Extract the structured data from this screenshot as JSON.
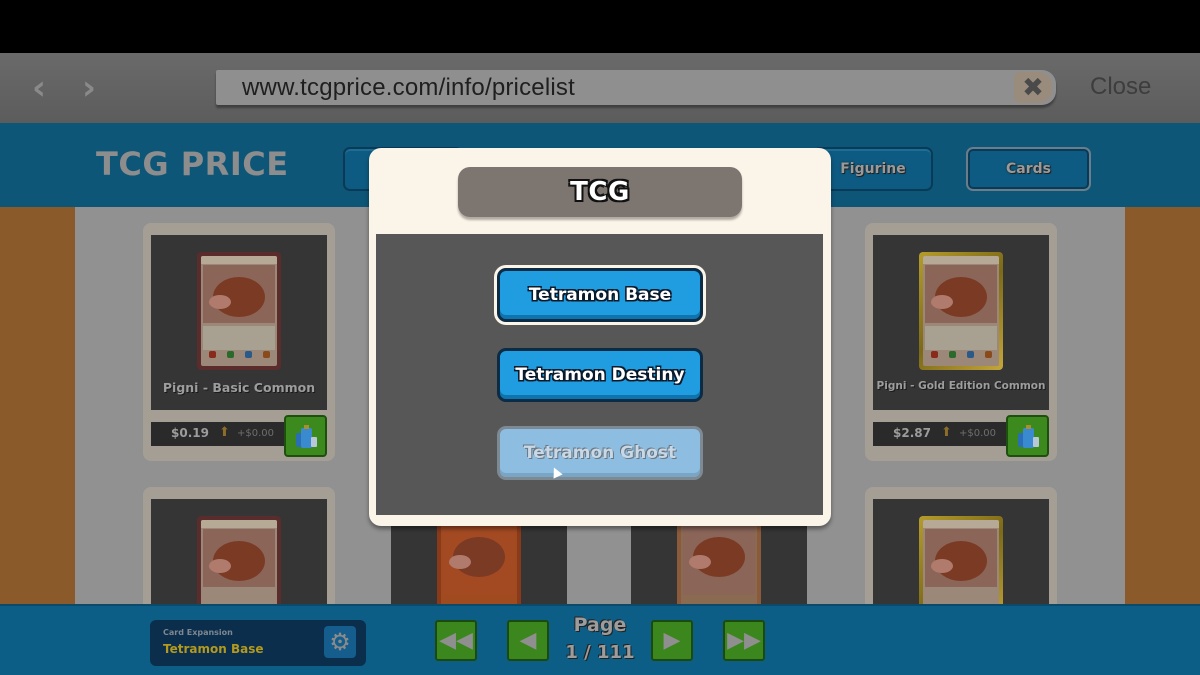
{
  "browser": {
    "back_icon": "chevron-left-icon",
    "forward_icon": "chevron-right-icon",
    "url": "www.tcgprice.com/info/pricelist",
    "clear_icon": "close-x-icon",
    "close_label": "Close"
  },
  "site": {
    "logo": "TCG PRICE",
    "nav": {
      "figurine": "Figurine",
      "cards": "Cards"
    }
  },
  "cards": [
    {
      "name": "Pigni - Basic Common",
      "price": "$0.19",
      "change": "+$0.00",
      "trend_icon": "arrow-up-icon",
      "edition": "basic"
    },
    {
      "name": "Pigni - Gold Edition Common",
      "price": "$2.87",
      "change": "+$0.00",
      "trend_icon": "arrow-up-icon",
      "edition": "gold"
    }
  ],
  "footer": {
    "expansion_label": "Card Expansion",
    "expansion_value": "Tetramon Base",
    "page_label": "Page",
    "page_count": "1 / 111",
    "current_page": 1,
    "total_pages": 111
  },
  "modal": {
    "title": "TCG",
    "options": [
      {
        "label": "Tetramon Base",
        "state": "selected"
      },
      {
        "label": "Tetramon Destiny",
        "state": "enabled"
      },
      {
        "label": "Tetramon Ghost",
        "state": "disabled"
      }
    ]
  },
  "colors": {
    "header_blue": "#0d5677",
    "side_brown": "#8b5a2b",
    "option_blue": "#1f9de0",
    "button_green": "#3c861e",
    "expansion_gold": "#b39a1f"
  }
}
